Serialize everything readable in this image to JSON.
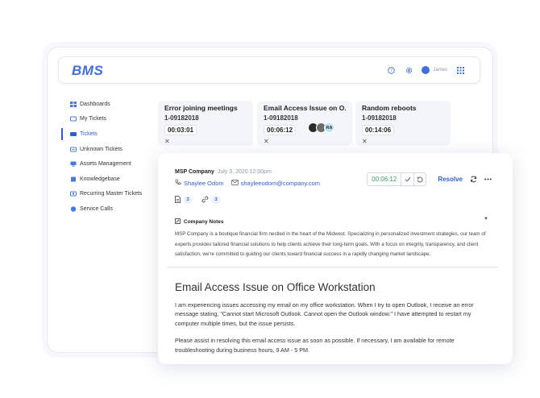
{
  "app": {
    "logo": "BMS",
    "user_name": "James"
  },
  "sidebar": {
    "items": [
      {
        "label": "Dashboards",
        "icon": "dashboard-icon"
      },
      {
        "label": "My Tickets",
        "icon": "ticket-icon"
      },
      {
        "label": "Tickets",
        "icon": "tickets-icon",
        "active": true
      },
      {
        "label": "Unknown Tickets",
        "icon": "unknown-ticket-icon"
      },
      {
        "label": "Assets Management",
        "icon": "assets-icon"
      },
      {
        "label": "Knowledgebase",
        "icon": "book-icon"
      },
      {
        "label": "Recurring Master Tickets",
        "icon": "recurring-icon"
      },
      {
        "label": "Service Calls",
        "icon": "service-call-icon"
      }
    ]
  },
  "tabs": [
    {
      "title": "Error joining meetings",
      "id": "1-09182018",
      "timer": "00:03:01"
    },
    {
      "title": "Email Access Issue on O...",
      "id": "1-09182018",
      "timer": "00:06:12",
      "avatars": [
        "",
        "",
        "RA"
      ]
    },
    {
      "title": "Random reboots",
      "id": "1-09182018",
      "timer": "00:14:06"
    }
  ],
  "ticket": {
    "company": "MSP Company",
    "date": "July 3, 2020 12:00pm",
    "contact_name": "Shaylee Odom",
    "contact_email": "shayleeodom@company.com",
    "attachments_count": "3",
    "links_count": "3",
    "timer": "00:06:12",
    "resolve_label": "Resolve",
    "notes_title": "Company Notes",
    "notes_text": "MSP Company is a boutique financial firm nestled in the heart of the Midwest. Specializing in personalized investment strategies, our team of experts provides tailored financial solutions to help clients achieve their long-term goals. With a focus on integrity, transparency, and client satisfaction, we're committed to guiding our clients toward financial success in a rapidly changing market landscape.",
    "subject": "Email Access Issue on Office Workstation",
    "description_1": "I am experiencing issues accessing my email on my office workstation. When I try to open Outlook, I receive an error message stating, \"Cannot start Microsoft Outlook. Cannot open the Outlook window.\" I have attempted to restart my computer multiple times, but the issue persists.",
    "description_2": "Please assist in resolving this email access issue as soon as possible. If necessary, I am available for remote troubleshooting during business hours, 9 AM - 5 PM."
  },
  "colors": {
    "accent": "#2f5fcf",
    "timer_green": "#3f9d5c"
  }
}
